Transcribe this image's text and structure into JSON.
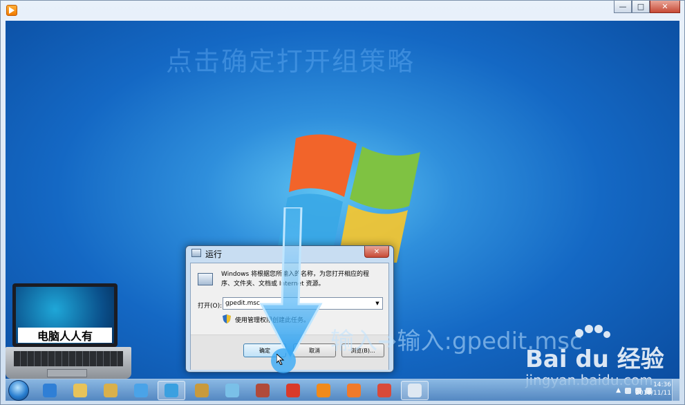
{
  "window": {
    "icon": "media-player-icon",
    "controls": {
      "minimize": "—",
      "maximize": "□",
      "close": "✕"
    }
  },
  "overlay": {
    "caption_top": "点击确定打开组策略",
    "caption_bottom": "输入➔输入:gpedit.msc",
    "laptop_label": "电脑人人有",
    "watermark_brand": "Bai du 经验",
    "watermark_url": "jingyan.baidu.com"
  },
  "run_dialog": {
    "title": "运行",
    "description": "Windows 将根据您所输入的名称，为您打开相应的程序、文件夹、文档或 Internet 资源。",
    "open_label": "打开(O):",
    "open_value": "gpedit.msc",
    "admin_text": "使用管理权限创建此任务。",
    "ok_label": "确定",
    "cancel_label": "取消",
    "browse_label": "浏览(B)...",
    "close_label": "✕"
  },
  "taskbar": {
    "items": [
      {
        "name": "ie-icon",
        "color": "#2f7fd6"
      },
      {
        "name": "folder-icon",
        "color": "#e8c35a"
      },
      {
        "name": "file-manager-icon",
        "color": "#d9b04b"
      },
      {
        "name": "qq-icon",
        "color": "#4aa3e8"
      },
      {
        "name": "browser-icon",
        "color": "#3aa0e0"
      },
      {
        "name": "paint-icon",
        "color": "#c89a3c"
      },
      {
        "name": "pinwheel-icon",
        "color": "#7ac0e8"
      },
      {
        "name": "tools-icon",
        "color": "#b04a3a"
      },
      {
        "name": "chess-icon",
        "color": "#d93a2a"
      },
      {
        "name": "media-player-icon",
        "color": "#f08a1a"
      },
      {
        "name": "fox-icon",
        "color": "#f07a2a"
      },
      {
        "name": "toolbox-icon",
        "color": "#d84a3a"
      },
      {
        "name": "run-icon",
        "color": "#dfe8f2"
      }
    ],
    "clock_time": "14:36",
    "clock_date": "2018/11/11"
  }
}
